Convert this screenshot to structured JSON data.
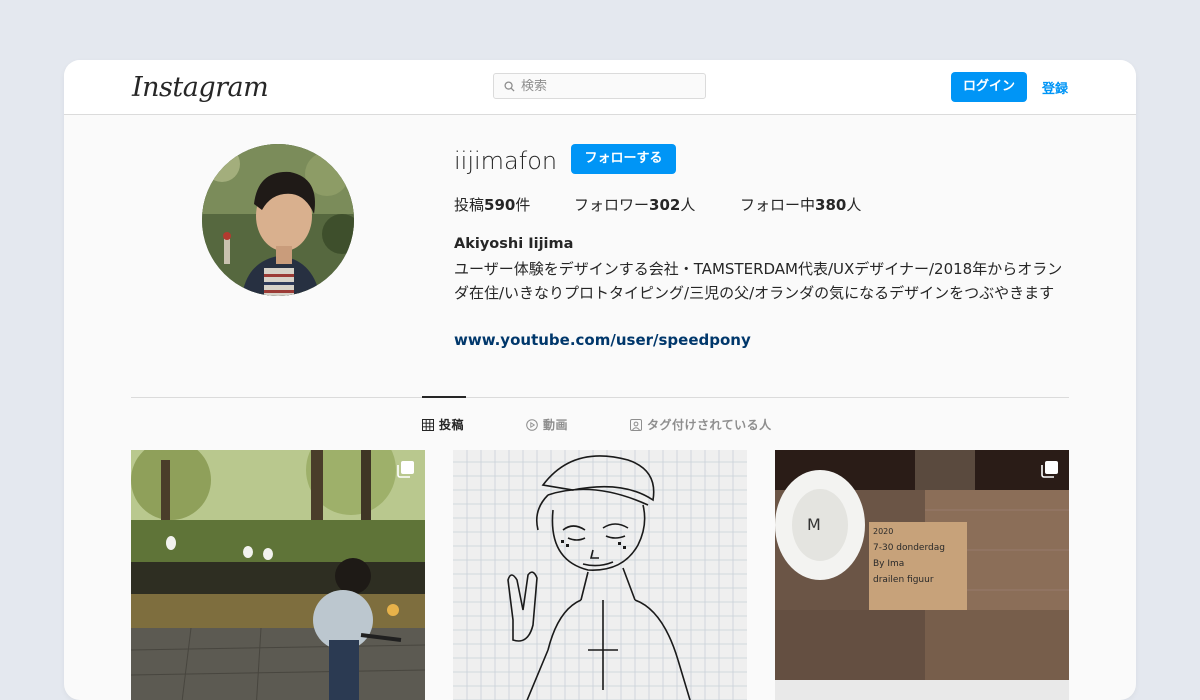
{
  "navbar": {
    "logo_text": "Instagram",
    "search_placeholder": "検索",
    "login_label": "ログイン",
    "register_label": "登録"
  },
  "profile": {
    "username": "iijimafon",
    "follow_label": "フォローする",
    "stats": {
      "posts_prefix": "投稿",
      "posts_count": "590",
      "posts_suffix": "件",
      "followers_prefix": "フォロワー",
      "followers_count": "302",
      "followers_suffix": "人",
      "following_prefix": "フォロー中",
      "following_count": "380",
      "following_suffix": "人"
    },
    "full_name": "Akiyoshi Iijima",
    "bio": "ユーザー体験をデザインする会社・TAMSTERDAM代表/UXデザイナー/2018年からオランダ在住/いきなりプロトタイピング/三児の父/オランダの気になるデザインをつぶやきます",
    "link": "www.youtube.com/user/speedpony"
  },
  "tabs": [
    {
      "label": "投稿",
      "icon": "grid-icon",
      "active": true
    },
    {
      "label": "動画",
      "icon": "play-icon",
      "active": false
    },
    {
      "label": "タグ付けされている人",
      "icon": "tagged-icon",
      "active": false
    }
  ],
  "posts": [
    {
      "subject": "child on balance bike in park with ducks",
      "multi": true
    },
    {
      "subject": "pen sketch of character on grid paper",
      "multi": false
    },
    {
      "subject": "plate and handwritten note in window",
      "multi": true
    }
  ],
  "note_text": {
    "line1": "2020",
    "line2": "7-30 donderdag",
    "line3": "By Ima",
    "line4": "drailen figuur"
  }
}
